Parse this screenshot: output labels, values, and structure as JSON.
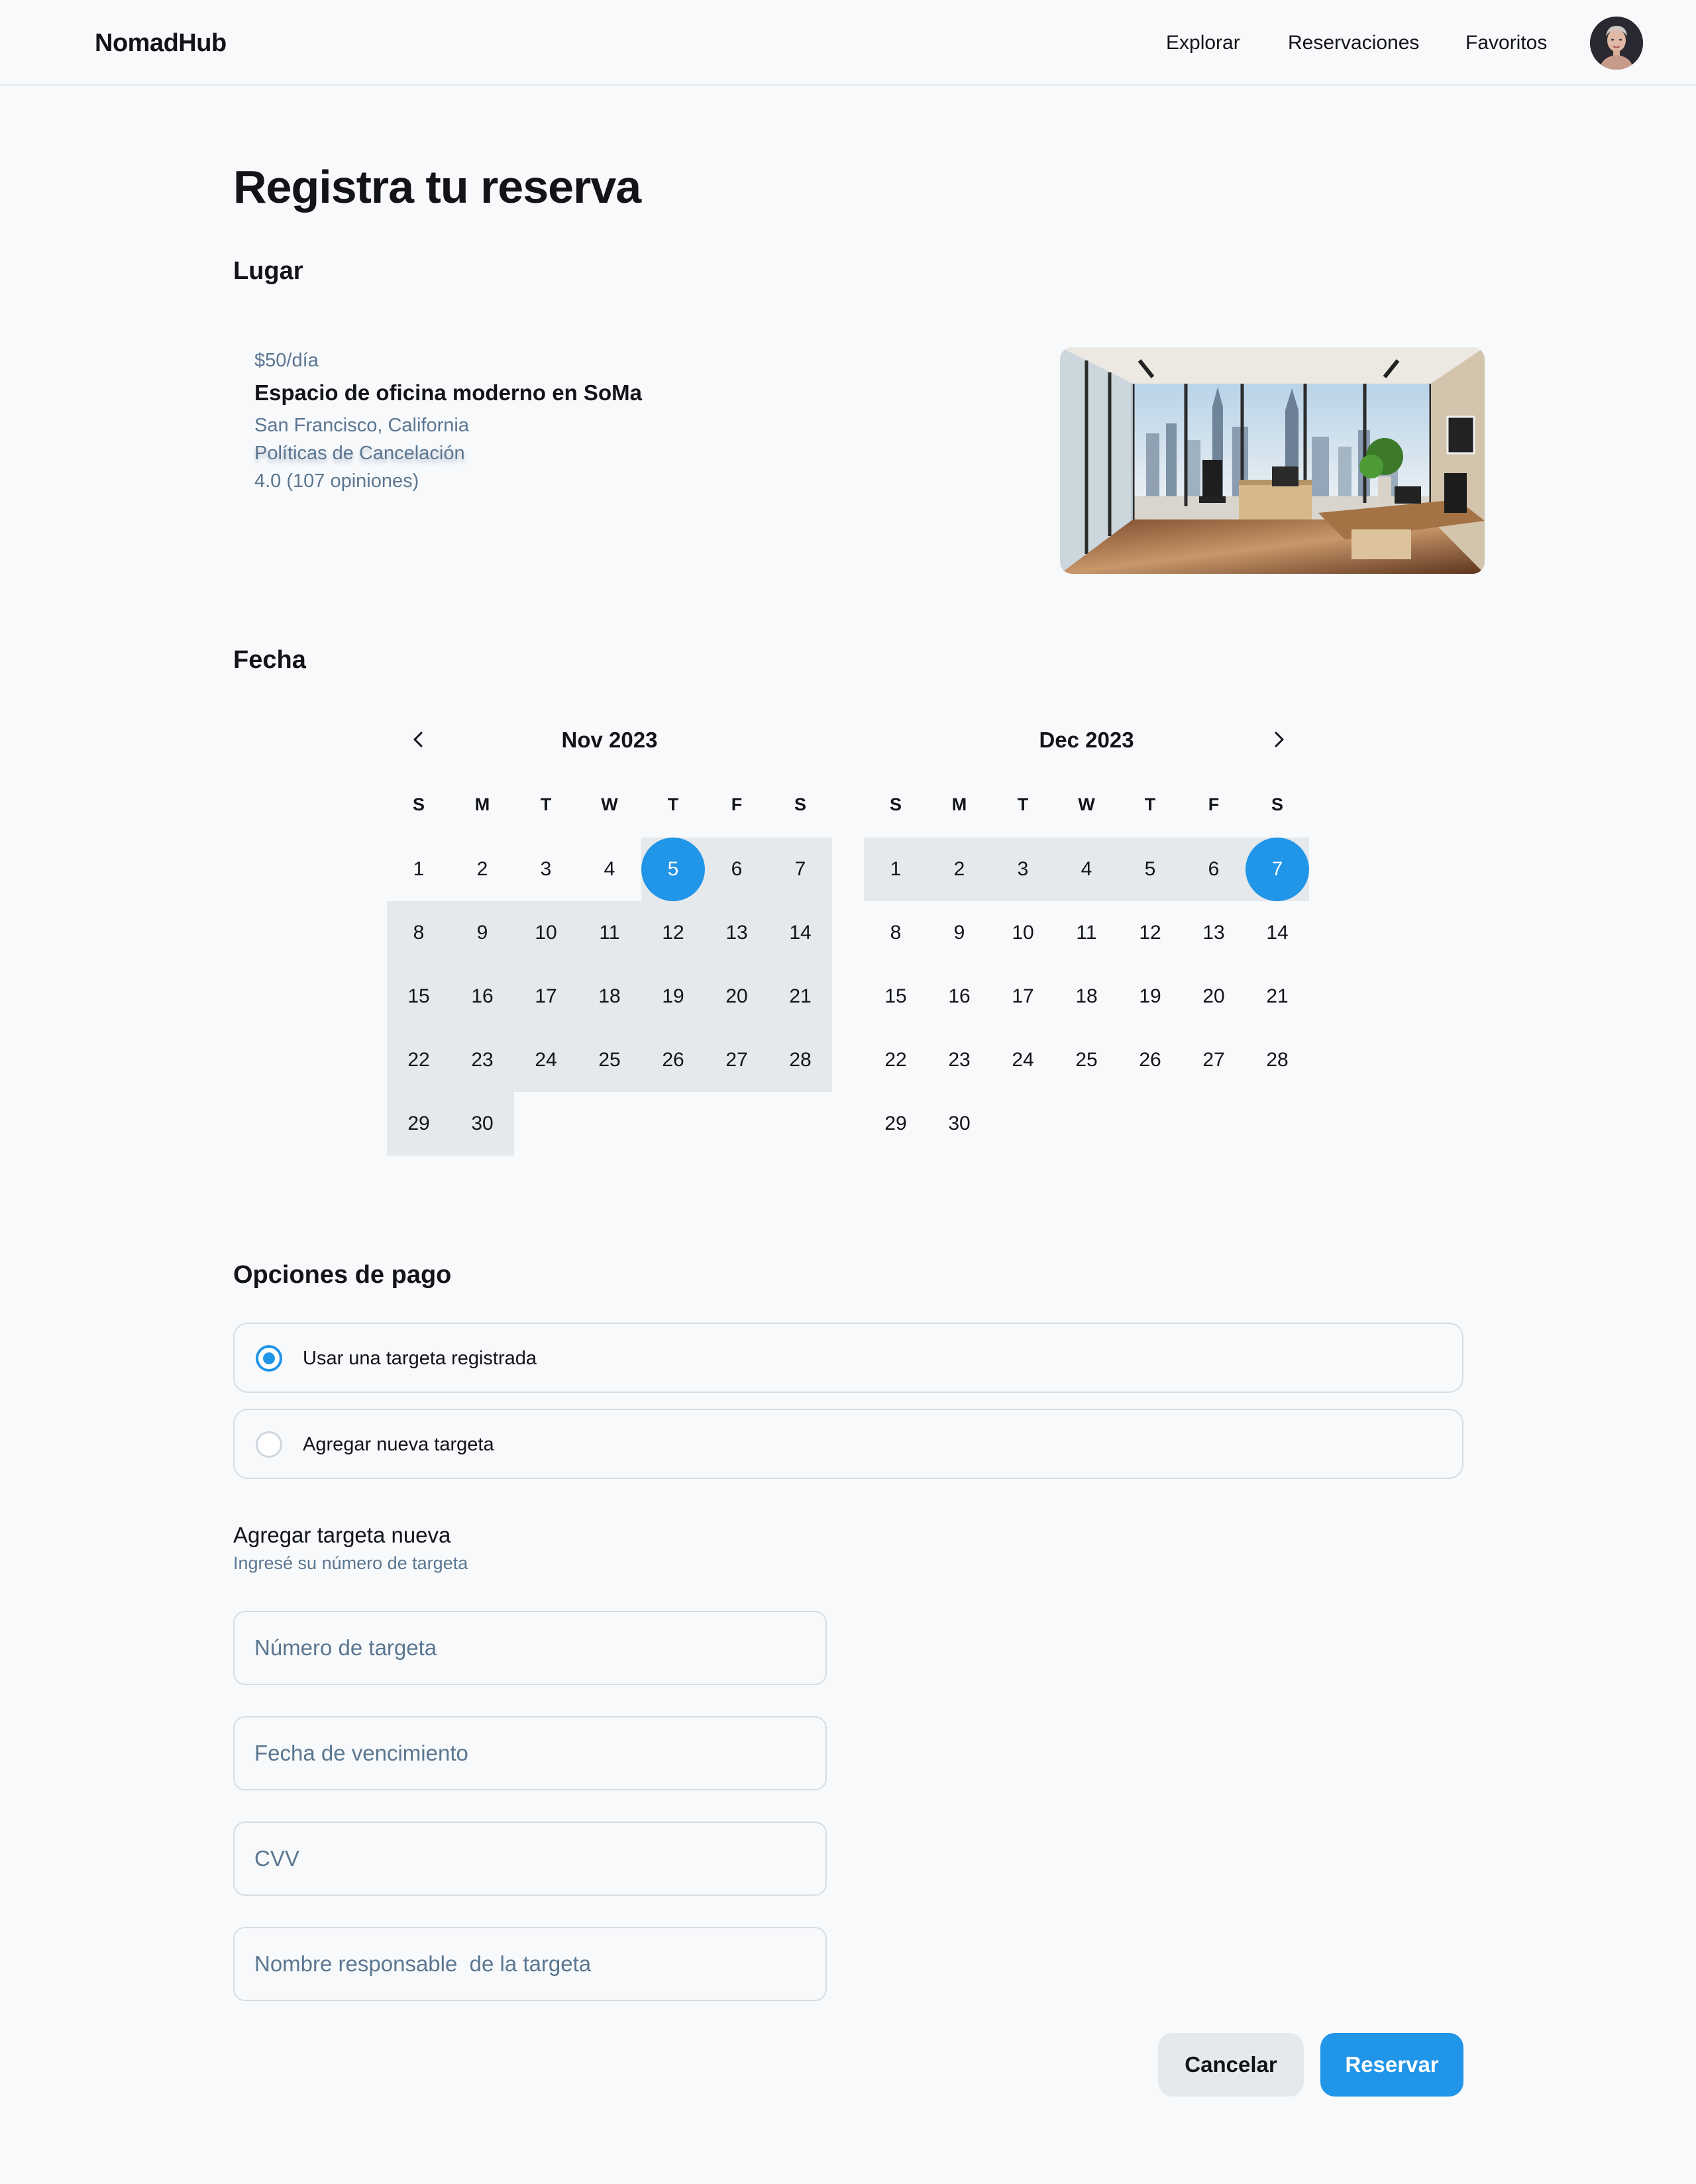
{
  "header": {
    "brand": "NomadHub",
    "nav": [
      "Explorar",
      "Reservaciones",
      "Favoritos"
    ],
    "avatar_icon": "user-avatar"
  },
  "page_title": "Registra tu reserva",
  "sections": {
    "lugar": "Lugar",
    "fecha": "Fecha",
    "pago": "Opciones de pago"
  },
  "place": {
    "price": "$50/día",
    "name": "Espacio de oficina moderno en SoMa",
    "location": "San Francisco, California",
    "policy_link": "Políticas de Cancelación",
    "rating": "4.0 (107 opiniones)",
    "image_icon": "office-photo"
  },
  "calendar": {
    "prev_icon": "chevron-left-icon",
    "next_icon": "chevron-right-icon",
    "weekdays": [
      "S",
      "M",
      "T",
      "W",
      "T",
      "F",
      "S"
    ],
    "months": [
      {
        "title": "Nov 2023",
        "first_weekday": 0,
        "days": 30,
        "selected": [
          5
        ],
        "range": [
          5,
          30
        ]
      },
      {
        "title": "Dec 2023",
        "first_weekday": 0,
        "days": 30,
        "selected": [
          7
        ],
        "range": [
          1,
          7
        ]
      }
    ],
    "selected_color": "#2195e8",
    "range_color": "#e6e9ec"
  },
  "payment": {
    "options": [
      {
        "label": "Usar una targeta registrada",
        "selected": true
      },
      {
        "label": "Agregar nueva targeta",
        "selected": false
      }
    ],
    "new_card_title": "Agregar targeta nueva",
    "new_card_subtitle": "Ingresé su número de targeta",
    "fields": {
      "card_number": "Número de targeta",
      "expiry": "Fecha de vencimiento",
      "cvv": "CVV",
      "holder": "Nombre responsable  de la targeta"
    }
  },
  "actions": {
    "cancel": "Cancelar",
    "book": "Reservar"
  },
  "colors": {
    "accent": "#2195e8",
    "muted_text": "#5b7690",
    "background": "#f7f9fb"
  }
}
